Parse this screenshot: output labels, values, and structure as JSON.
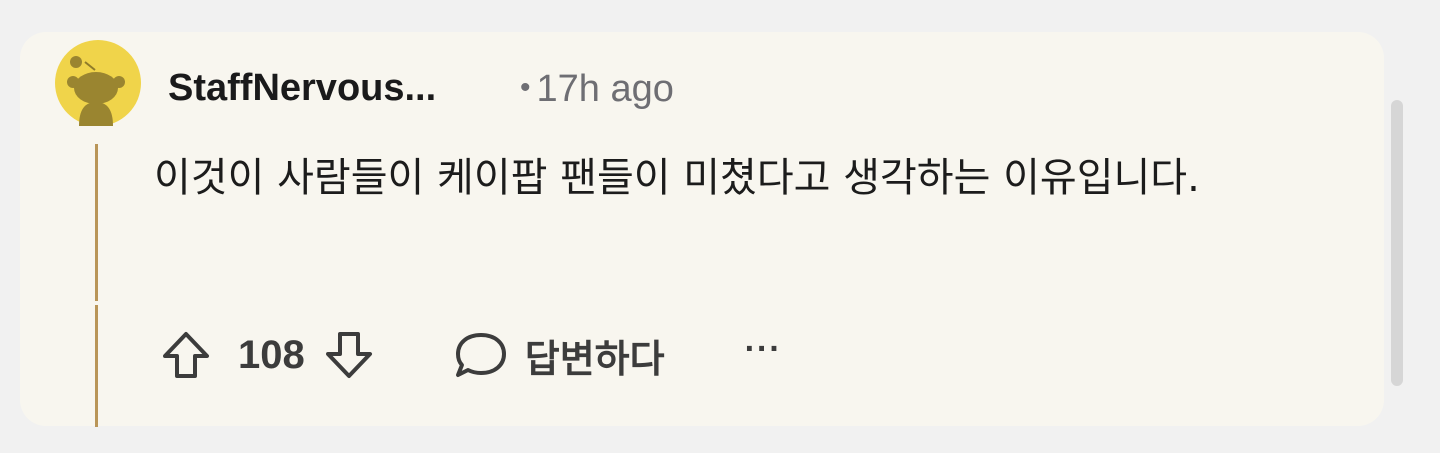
{
  "comment": {
    "username": "StaffNervous...",
    "time_ago": "17h ago",
    "meta_separator": "•",
    "body": "이것이 사람들이 케이팝 팬들이 미쳤다고 생각하는 이유입니다.",
    "avatar_icon": "reddit-snoo-avatar-icon",
    "avatar_color": "#f0d44a",
    "thread_line_color": "#b99558"
  },
  "actions": {
    "upvote_icon": "arrow-up-icon",
    "vote_count": "108",
    "downvote_icon": "arrow-down-icon",
    "reply_icon": "speech-bubble-icon",
    "reply_label": "답변하다",
    "more_label": "···"
  }
}
